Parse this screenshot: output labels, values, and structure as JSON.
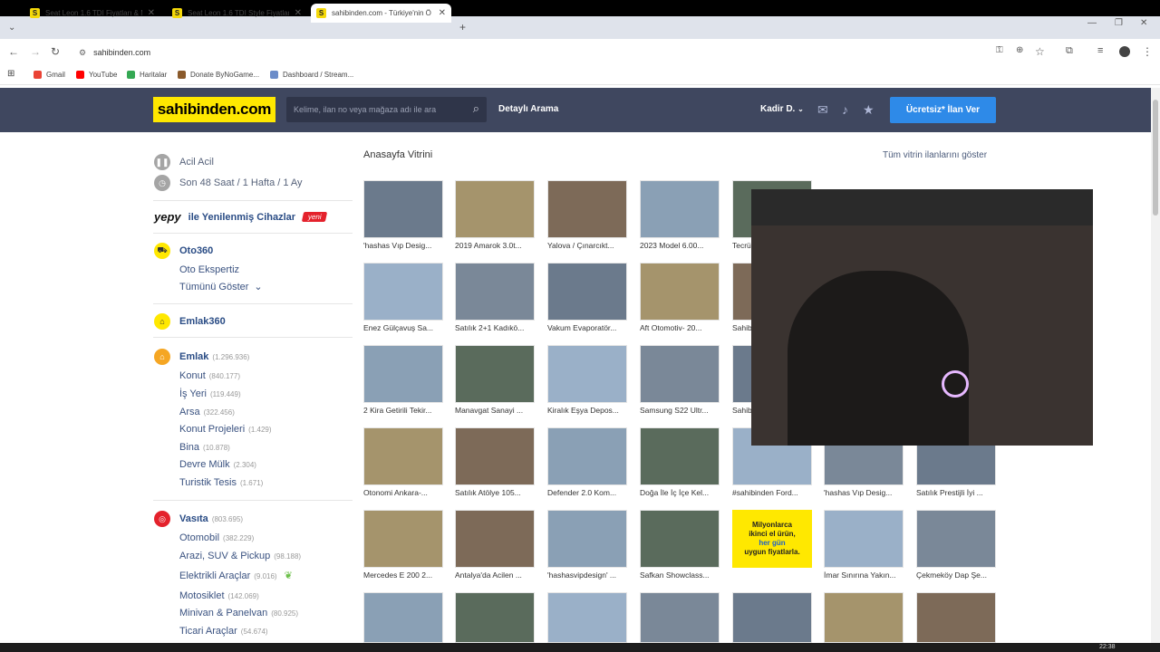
{
  "browser": {
    "tabs": [
      {
        "title": "Seat Leon 1.6 TDI Fiyatları & M",
        "active": false
      },
      {
        "title": "Seat Leon 1.6 TDI Style Fiyatları",
        "active": false
      },
      {
        "title": "sahibinden.com - Türkiye'nin Ö",
        "active": true
      }
    ],
    "new_tab": "+",
    "url": "sahibinden.com",
    "bookmarks": [
      "Gmail",
      "YouTube",
      "Haritalar",
      "Donate ByNoGame...",
      "Dashboard / Stream..."
    ]
  },
  "header": {
    "logo": "sahibinden.com",
    "search_placeholder": "Kelime, ilan no veya mağaza adı ile ara",
    "detailed_search": "Detaylı Arama",
    "user": "Kadir D.",
    "cta": "Ücretsiz* İlan Ver"
  },
  "sidebar": {
    "urgent": "Acil Acil",
    "recent": "Son 48 Saat / 1 Hafta / 1 Ay",
    "yepy": "yepy",
    "yepy_text": "ile Yenilenmiş Cihazlar",
    "yepy_badge": "yeni",
    "oto360": "Oto360",
    "oto_ekspertiz": "Oto Ekspertiz",
    "show_all": "Tümünü Göster",
    "emlak360": "Emlak360",
    "emlak": {
      "label": "Emlak",
      "count": "(1.296.936)"
    },
    "emlak_subs": [
      {
        "label": "Konut",
        "count": "(840.177)"
      },
      {
        "label": "İş Yeri",
        "count": "(119.449)"
      },
      {
        "label": "Arsa",
        "count": "(322.456)"
      },
      {
        "label": "Konut Projeleri",
        "count": "(1.429)"
      },
      {
        "label": "Bina",
        "count": "(10.878)"
      },
      {
        "label": "Devre Mülk",
        "count": "(2.304)"
      },
      {
        "label": "Turistik Tesis",
        "count": "(1.671)"
      }
    ],
    "vasita": {
      "label": "Vasıta",
      "count": "(803.695)"
    },
    "vasita_subs": [
      {
        "label": "Otomobil",
        "count": "(382.229)"
      },
      {
        "label": "Arazi, SUV & Pickup",
        "count": "(98.188)"
      },
      {
        "label": "Elektrikli Araçlar",
        "count": "(9.016)"
      },
      {
        "label": "Motosiklet",
        "count": "(142.069)"
      },
      {
        "label": "Minivan & Panelvan",
        "count": "(80.925)"
      },
      {
        "label": "Ticari Araçlar",
        "count": "(54.674)"
      }
    ]
  },
  "vitrin": {
    "title": "Anasayfa Vitrini",
    "show_all": "Tüm vitrin ilanlarını göster",
    "captions": [
      "'hashas Vıp Desig...",
      "2019 Amarok 3.0t...",
      "Yalova / Çınarcıkt...",
      "2023 Model 6.00...",
      "Tecrü",
      "Enez Gülçavuş Sa...",
      "Satılık 2+1 Kadıkö...",
      "Vakum Evaporatör...",
      "Aft Otomotiv- 20...",
      "Sahib",
      "2 Kira Getirili Tekir...",
      "Manavgat Sanayi ...",
      "Kiralık Eşya Depos...",
      "Samsung S22 Ultr...",
      "Sahib",
      "Otonomi Ankara-...",
      "Satılık Atölye 105...",
      "Defender 2.0 Kom...",
      "Doğa İle İç İçe Kel...",
      "#sahibinden Ford...",
      "'hashas Vıp Desig...",
      "Satılık Prestijli İyi ...",
      "Mercedes E 200 2...",
      "Antalya'da Acilen ...",
      "'hashasvipdesign' ...",
      "Safkan Showclass...",
      "İmar Sınırına Yakın...",
      "Çekmeköy Dap Şe..."
    ],
    "promo": [
      "Milyonlarca",
      "ikinci el ürün,",
      "her gün",
      "uygun fiyatlarla."
    ]
  },
  "taskbar": {
    "clock": "22:38"
  }
}
